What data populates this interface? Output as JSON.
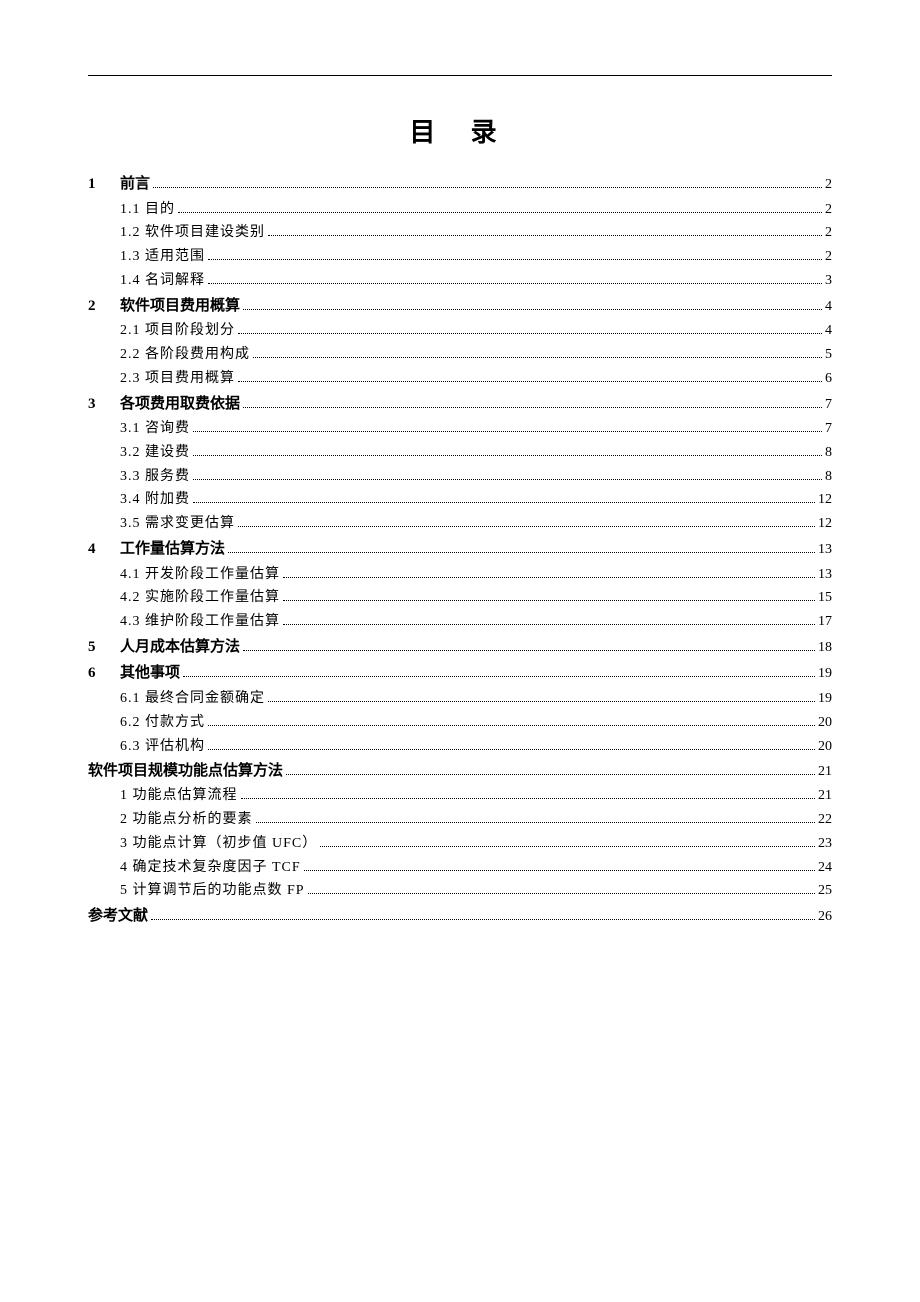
{
  "title": "目 录",
  "entries": [
    {
      "num": "1",
      "label": "前言",
      "page": "2",
      "level": 0
    },
    {
      "num": "",
      "label": "1.1 目的",
      "page": "2",
      "level": 1
    },
    {
      "num": "",
      "label": "1.2 软件项目建设类别",
      "page": "2",
      "level": 1
    },
    {
      "num": "",
      "label": "1.3 适用范围",
      "page": "2",
      "level": 1
    },
    {
      "num": "",
      "label": "1.4 名词解释",
      "page": "3",
      "level": 1
    },
    {
      "num": "2",
      "label": "软件项目费用概算",
      "page": "4",
      "level": 0
    },
    {
      "num": "",
      "label": "2.1 项目阶段划分",
      "page": "4",
      "level": 1
    },
    {
      "num": "",
      "label": "2.2 各阶段费用构成",
      "page": "5",
      "level": 1
    },
    {
      "num": "",
      "label": "2.3 项目费用概算",
      "page": "6",
      "level": 1
    },
    {
      "num": "3",
      "label": "各项费用取费依据",
      "page": "7",
      "level": 0
    },
    {
      "num": "",
      "label": "3.1 咨询费",
      "page": "7",
      "level": 1
    },
    {
      "num": "",
      "label": "3.2 建设费",
      "page": "8",
      "level": 1
    },
    {
      "num": "",
      "label": "3.3 服务费",
      "page": "8",
      "level": 1
    },
    {
      "num": "",
      "label": "3.4 附加费",
      "page": "12",
      "level": 1
    },
    {
      "num": "",
      "label": "3.5 需求变更估算",
      "page": "12",
      "level": 1
    },
    {
      "num": "4",
      "label": "工作量估算方法",
      "page": "13",
      "level": 0
    },
    {
      "num": "",
      "label": "4.1 开发阶段工作量估算",
      "page": "13",
      "level": 1
    },
    {
      "num": "",
      "label": "4.2 实施阶段工作量估算",
      "page": "15",
      "level": 1
    },
    {
      "num": "",
      "label": "4.3 维护阶段工作量估算",
      "page": "17",
      "level": 1
    },
    {
      "num": "5",
      "label": "人月成本估算方法",
      "page": "18",
      "level": 0
    },
    {
      "num": "6",
      "label": "其他事项",
      "page": "19",
      "level": 0
    },
    {
      "num": "",
      "label": "6.1 最终合同金额确定",
      "page": "19",
      "level": 1
    },
    {
      "num": "",
      "label": "6.2 付款方式",
      "page": "20",
      "level": 1
    },
    {
      "num": "",
      "label": "6.3 评估机构",
      "page": "20",
      "level": 1
    },
    {
      "num": "",
      "label": "软件项目规模功能点估算方法",
      "page": "21",
      "level": 0,
      "nonum": true
    },
    {
      "num": "",
      "label": "1 功能点估算流程",
      "page": "21",
      "level": 1
    },
    {
      "num": "",
      "label": "2 功能点分析的要素",
      "page": "22",
      "level": 1
    },
    {
      "num": "",
      "label": "3 功能点计算（初步值 UFC）",
      "page": "23",
      "level": 1
    },
    {
      "num": "",
      "label": "4 确定技术复杂度因子 TCF",
      "page": "24",
      "level": 1
    },
    {
      "num": "",
      "label": "5 计算调节后的功能点数 FP",
      "page": "25",
      "level": 1
    },
    {
      "num": "",
      "label": "参考文献",
      "page": "26",
      "level": 0,
      "nonum": true
    }
  ]
}
